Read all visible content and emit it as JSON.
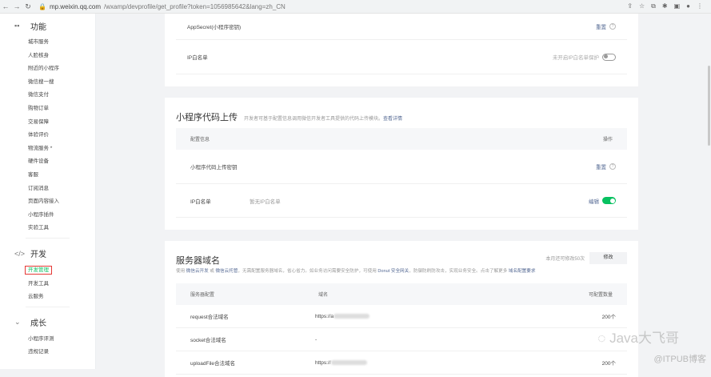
{
  "browser": {
    "url_host": "mp.weixin.qq.com",
    "url_path": "/wxamp/devprofile/get_profile?token=1056985642&lang=zh_CN"
  },
  "sidebar": {
    "sections": [
      {
        "title": "功能",
        "icon": "grid-icon",
        "items": [
          "城市服务",
          "人脸核身",
          "附近的小程序",
          "微信搜一搜",
          "微信支付",
          "购物订单",
          "交易保障",
          "体验评价",
          "物流服务 *",
          "硬件设备",
          "客服",
          "订阅消息",
          "页面内容接入",
          "小程序插件",
          "实验工具"
        ]
      },
      {
        "title": "开发",
        "icon": "code-icon",
        "items": [
          "开发管理",
          "开发工具",
          "云服务"
        ],
        "active": "开发管理"
      },
      {
        "title": "成长",
        "icon": "chevron-down-icon",
        "items": [
          "小程序评测",
          "违规记录"
        ]
      }
    ]
  },
  "card1": {
    "appsecret_label": "AppSecret(小程序密钥)",
    "reset": "重置",
    "help": "?",
    "ip_label": "IP白名单",
    "ip_status": "未开启IP白名单保护",
    "ip_toggle_on": false
  },
  "card2": {
    "title": "小程序代码上传",
    "desc": "开发者可基于配置信息调用微信开发者工具提供的代码上传模块。",
    "desc_link": "查看详情",
    "col_config": "配置信息",
    "col_action": "操作",
    "key_label": "小程序代码上传密钥",
    "reset": "重置",
    "help": "?",
    "ip_label": "IP白名单",
    "ip_value": "暂无IP白名单",
    "edit": "编辑",
    "ip_toggle_on": true
  },
  "card3": {
    "title": "服务器域名",
    "remaining": "本月还可修改50次",
    "modify": "修改",
    "desc_parts": {
      "p1": "使用 ",
      "l1": "微信云开发",
      "p2": " 或 ",
      "l2": "微信云托管",
      "p3": "，无需配置服务器域名，省心省力。如业务访问需要安全防护，可使用 ",
      "l3": "Donut 安全网关",
      "p4": "，防御防刷防攻击，实现业务安全。点击了解更多 ",
      "l4": "域名配置要求"
    },
    "columns": [
      "服务器配置",
      "域名",
      "可配置数量"
    ],
    "rows": [
      {
        "name": "request合法域名",
        "domain": "https://a",
        "count": "200个"
      },
      {
        "name": "socket合法域名",
        "domain": "-",
        "count": ""
      },
      {
        "name": "uploadFile合法域名",
        "domain": "https://",
        "count": "200个"
      }
    ]
  },
  "watermark": {
    "line1": "Java大飞哥",
    "line2": "@ITPUB博客"
  }
}
